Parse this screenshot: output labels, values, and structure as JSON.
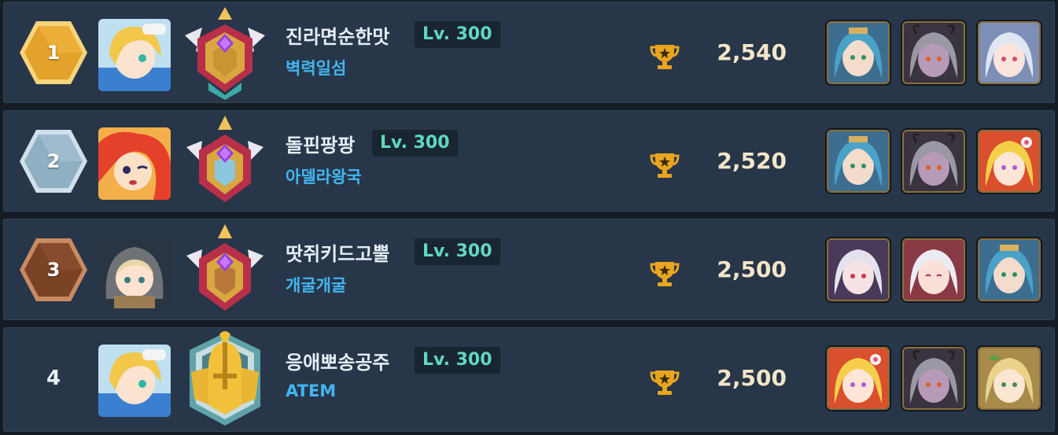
{
  "rows": [
    {
      "rank": "1",
      "rank_style": "gold",
      "avatar": "blonde-hero-avatar",
      "emblem": "diamond-rank-emblem",
      "name": "진라면순한맛",
      "level": "Lv. 300",
      "guild": "벽력일섬",
      "score": "2,540",
      "heroes": [
        "blue-hair-hero",
        "gray-horned-hero",
        "silver-hair-hero"
      ]
    },
    {
      "rank": "2",
      "rank_style": "silver",
      "avatar": "red-hair-hero-avatar",
      "emblem": "diamond-rank-emblem",
      "name": "돌핀팡팡",
      "level": "Lv. 300",
      "guild": "아델라왕국",
      "score": "2,520",
      "heroes": [
        "blue-hair-hero",
        "gray-horned-hero",
        "blonde-flower-hero"
      ]
    },
    {
      "rank": "3",
      "rank_style": "bronze",
      "avatar": "hooded-hero-avatar",
      "emblem": "diamond-rank-emblem",
      "name": "땃쥐키드고뿔",
      "level": "Lv. 300",
      "guild": "개굴개굴",
      "score": "2,500",
      "heroes": [
        "white-hair-hero",
        "silver-smile-hero",
        "blue-hair-hero"
      ]
    },
    {
      "rank": "4",
      "rank_style": "plain",
      "avatar": "blonde-hero-avatar",
      "emblem": "gold-helmet-emblem",
      "name": "응애뽀송공주",
      "level": "Lv. 300",
      "guild": "ATEM",
      "score": "2,500",
      "heroes": [
        "blonde-flower-hero",
        "gray-horned-hero",
        "blonde-leaf-hero"
      ]
    }
  ],
  "colors": {
    "gold": "#e0a02a",
    "silver": "#8fb0c2",
    "bronze": "#8a4e2c",
    "level_text": "#5fd8c0",
    "guild_text": "#42b6f0",
    "score_text": "#f3e6c8"
  }
}
